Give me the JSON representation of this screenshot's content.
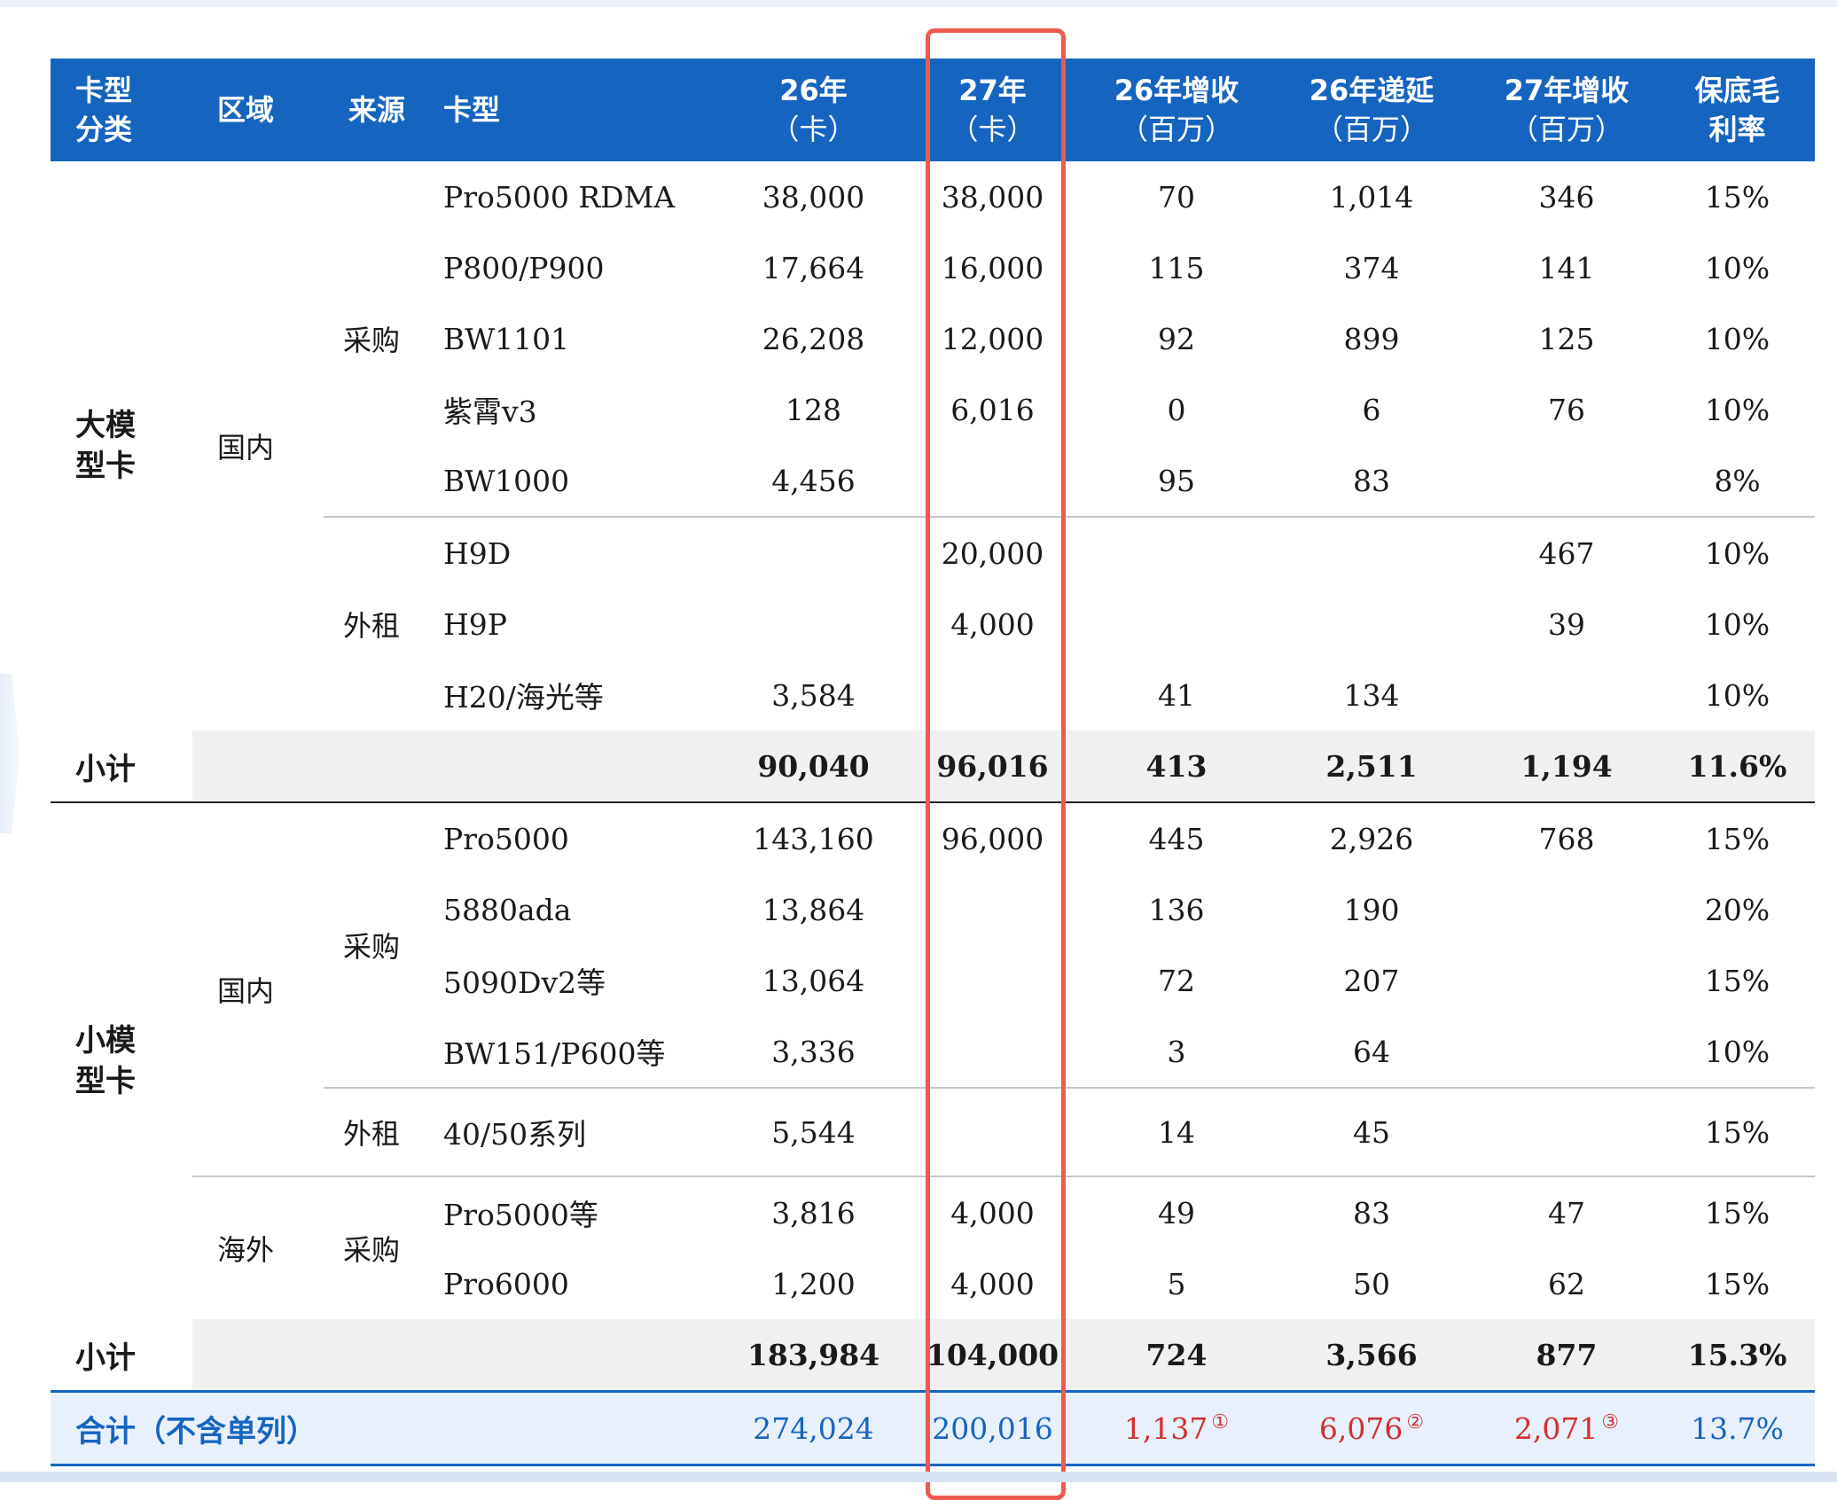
{
  "header": {
    "col1": [
      "卡型",
      "分类"
    ],
    "col2": "区域",
    "col3": "来源",
    "col4": "卡型",
    "col5": [
      "26年",
      "（卡）"
    ],
    "col6": [
      "27年",
      "（卡）"
    ],
    "col7": [
      "26年增收",
      "（百万）"
    ],
    "col8": [
      "26年递延",
      "（百万）"
    ],
    "col9": [
      "27年增收",
      "（百万）"
    ],
    "col10": [
      "保底毛",
      "利率"
    ]
  },
  "groups": {
    "large": [
      "大模",
      "型卡"
    ],
    "small": [
      "小模",
      "型卡"
    ]
  },
  "regions": {
    "domestic": "国内",
    "overseas": "海外"
  },
  "sources": {
    "purchase": "采购",
    "rent": "外租"
  },
  "rows": [
    {
      "model": "Pro5000 RDMA",
      "y26": "38,000",
      "y27": "38,000",
      "inc26": "70",
      "def26": "1,014",
      "inc27": "346",
      "margin": "15%"
    },
    {
      "model": "P800/P900",
      "y26": "17,664",
      "y27": "16,000",
      "inc26": "115",
      "def26": "374",
      "inc27": "141",
      "margin": "10%"
    },
    {
      "model": "BW1101",
      "y26": "26,208",
      "y27": "12,000",
      "inc26": "92",
      "def26": "899",
      "inc27": "125",
      "margin": "10%"
    },
    {
      "model": "紫霄v3",
      "y26": "128",
      "y27": "6,016",
      "inc26": "0",
      "def26": "6",
      "inc27": "76",
      "margin": "10%"
    },
    {
      "model": "BW1000",
      "y26": "4,456",
      "y27": "",
      "inc26": "95",
      "def26": "83",
      "inc27": "",
      "margin": "8%"
    },
    {
      "model": "H9D",
      "y26": "",
      "y27": "20,000",
      "inc26": "",
      "def26": "",
      "inc27": "467",
      "margin": "10%"
    },
    {
      "model": "H9P",
      "y26": "",
      "y27": "4,000",
      "inc26": "",
      "def26": "",
      "inc27": "39",
      "margin": "10%"
    },
    {
      "model": "H20/海光等",
      "y26": "3,584",
      "y27": "",
      "inc26": "41",
      "def26": "134",
      "inc27": "",
      "margin": "10%"
    },
    {
      "model": "Pro5000",
      "y26": "143,160",
      "y27": "96,000",
      "inc26": "445",
      "def26": "2,926",
      "inc27": "768",
      "margin": "15%"
    },
    {
      "model": "5880ada",
      "y26": "13,864",
      "y27": "",
      "inc26": "136",
      "def26": "190",
      "inc27": "",
      "margin": "20%"
    },
    {
      "model": "5090Dv2等",
      "y26": "13,064",
      "y27": "",
      "inc26": "72",
      "def26": "207",
      "inc27": "",
      "margin": "15%"
    },
    {
      "model": "BW151/P600等",
      "y26": "3,336",
      "y27": "",
      "inc26": "3",
      "def26": "64",
      "inc27": "",
      "margin": "10%"
    },
    {
      "model": "40/50系列",
      "y26": "5,544",
      "y27": "",
      "inc26": "14",
      "def26": "45",
      "inc27": "",
      "margin": "15%"
    },
    {
      "model": "Pro5000等",
      "y26": "3,816",
      "y27": "4,000",
      "inc26": "49",
      "def26": "83",
      "inc27": "47",
      "margin": "15%"
    },
    {
      "model": "Pro6000",
      "y26": "1,200",
      "y27": "4,000",
      "inc26": "5",
      "def26": "50",
      "inc27": "62",
      "margin": "15%"
    }
  ],
  "subtotals": [
    {
      "label": "小计",
      "y26": "90,040",
      "y27": "96,016",
      "inc26": "413",
      "def26": "2,511",
      "inc27": "1,194",
      "margin": "11.6%"
    },
    {
      "label": "小计",
      "y26": "183,984",
      "y27": "104,000",
      "inc26": "724",
      "def26": "3,566",
      "inc27": "877",
      "margin": "15.3%"
    }
  ],
  "total": {
    "label": "合计（不含单列）",
    "y26": "274,024",
    "y27": "200,016",
    "inc26": "1,137",
    "inc26_note": "①",
    "def26": "6,076",
    "def26_note": "②",
    "inc27": "2,071",
    "inc27_note": "③",
    "margin": "13.7%"
  },
  "colors": {
    "header_bg": "#1565c0",
    "highlight_border": "#ee5a4f",
    "total_text": "#1565c0",
    "total_red": "#d32f2f",
    "total_bg": "#e8f0fb",
    "subtotal_bg": "#f0f0f0"
  }
}
